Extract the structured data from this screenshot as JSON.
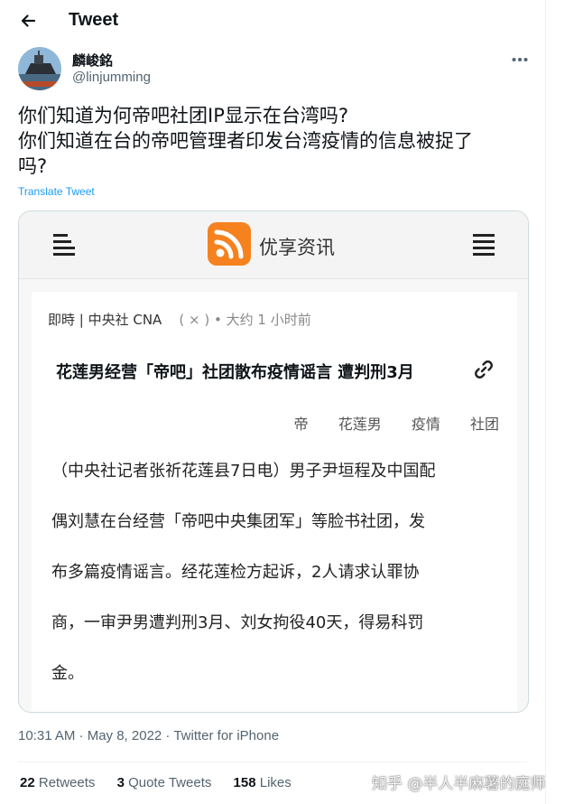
{
  "header": {
    "title": "Tweet"
  },
  "author": {
    "name": "麟峻銘",
    "handle": "@linjumming"
  },
  "tweet": {
    "lines": [
      "你们知道为何帝吧社团IP显示在台湾吗?",
      "你们知道在台的帝吧管理者印发台湾疫情的信息被捉了",
      "吗?"
    ],
    "translate_label": "Translate Tweet",
    "timestamp": "10:31 AM · May 8, 2022 · Twitter for iPhone"
  },
  "card": {
    "brand": "优享资讯",
    "meta_source": "即時 | 中央社 CNA",
    "meta_close": "( × )",
    "meta_time": "• 大约 1 小时前",
    "headline": "花莲男经营「帝吧」社团散布疫情谣言 遭判刑3月",
    "tags": [
      "帝",
      "花莲男",
      "疫情",
      "社团"
    ],
    "body_lines": [
      "（中央社记者张祈花莲县7日电）男子尹垣程及中国配",
      "偶刘慧在台经营「帝吧中央集团军」等脸书社团，发",
      "布多篇疫情谣言。经花莲检方起诉，2人请求认罪协",
      "商，一审尹男遭判刑3月、刘女拘役40天，得易科罚",
      "金。"
    ]
  },
  "stats": {
    "retweets_count": "22",
    "retweets_label": "Retweets",
    "quotes_count": "3",
    "quotes_label": "Quote Tweets",
    "likes_count": "158",
    "likes_label": "Likes"
  },
  "watermark": "知乎 @半人半麻薯的庭师",
  "colors": {
    "link": "#1d9bf0",
    "rss": "#f5821f",
    "muted": "#536471"
  },
  "icons": [
    "back-arrow-icon",
    "more-icon",
    "hamburger-menu-icon",
    "rss-icon",
    "link-icon"
  ]
}
